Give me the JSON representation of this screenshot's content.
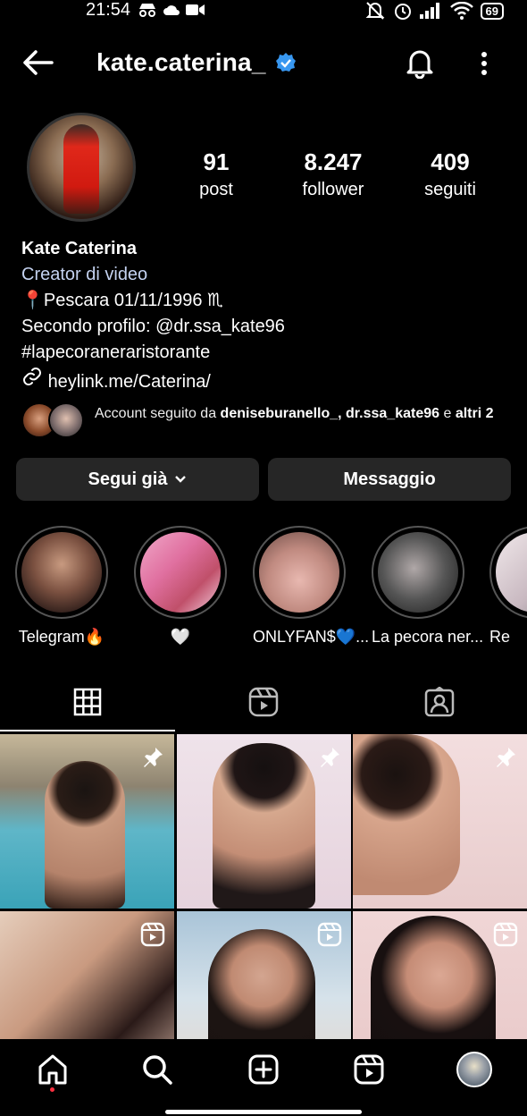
{
  "status_bar": {
    "time": "21:54",
    "battery": "69",
    "colors": {
      "bg": "#000000",
      "fg": "#ffffff"
    }
  },
  "header": {
    "username": "kate.caterina_",
    "verified_icon": "verified-badge-icon",
    "accent": "#3897f0"
  },
  "profile": {
    "stats": [
      {
        "value": "91",
        "label": "post"
      },
      {
        "value": "8.247",
        "label": "follower"
      },
      {
        "value": "409",
        "label": "seguiti"
      }
    ],
    "bio": {
      "name": "Kate Caterina",
      "category": "Creator di video",
      "line1": "📍Pescara 01/11/1996 ♏",
      "line2": "Secondo profilo: @dr.ssa_kate96",
      "line3": "#lapecoraneraristorante",
      "link": "heylink.me/Caterina/"
    },
    "followed_by": {
      "prefix": "Account seguito da ",
      "names": "deniseburanello_, dr.ssa_kate96",
      "suffix": " e ",
      "others": "altri 2"
    }
  },
  "actions": {
    "follow_label": "Segui già",
    "message_label": "Messaggio"
  },
  "highlights": [
    {
      "label": "Telegram🔥"
    },
    {
      "label": "🤍"
    },
    {
      "label": "ONLYFAN$💙..."
    },
    {
      "label": "La pecora ner..."
    },
    {
      "label": "Re"
    }
  ],
  "tabs": [
    "grid-icon",
    "reels-icon",
    "tagged-icon"
  ],
  "grid": [
    {
      "type": "pinned"
    },
    {
      "type": "pinned"
    },
    {
      "type": "pinned"
    },
    {
      "type": "reel"
    },
    {
      "type": "reel"
    },
    {
      "type": "reel"
    }
  ],
  "bottom_nav": [
    "home-icon",
    "search-icon",
    "create-icon",
    "reels-icon",
    "profile-avatar"
  ]
}
